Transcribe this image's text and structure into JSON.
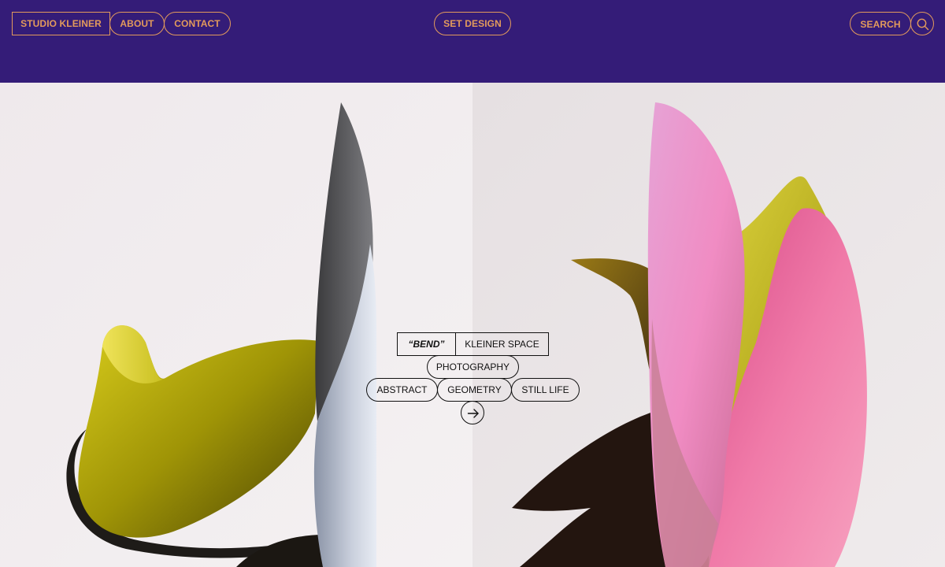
{
  "nav": {
    "brand": "STUDIO KLEINER",
    "about": "ABOUT",
    "contact": "CONTACT",
    "category": "SET DESIGN",
    "search": "SEARCH",
    "search_icon": "search-icon"
  },
  "project": {
    "title": "“BEND”",
    "client": "KLEINER SPACE",
    "tags": [
      "PHOTOGRAPHY",
      "ABSTRACT",
      "GEOMETRY",
      "STILL LIFE"
    ],
    "open_icon": "arrow-right-icon"
  },
  "colors": {
    "header_bg": "#341c78",
    "accent": "#e29a5c",
    "outline_dark": "#111111"
  }
}
